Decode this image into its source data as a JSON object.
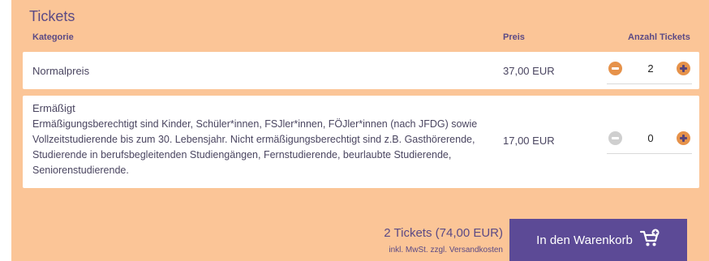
{
  "section": {
    "title": "Tickets",
    "headers": {
      "category": "Kategorie",
      "price": "Preis",
      "quantity": "Anzahl Tickets"
    }
  },
  "rows": [
    {
      "label": "Normalpreis",
      "price": "37,00 EUR",
      "quantity": "2",
      "minus_enabled": true
    },
    {
      "label": "Ermäßigt",
      "description": "Ermäßigungsberechtigt sind Kinder, Schüler*innen, FSJler*innen, FÖJler*innen (nach JFDG) sowie Vollzeitstudierende bis zum 30. Lebensjahr. Nicht ermäßigungsberechtigt sind z.B. Gasthörerende, Studierende in berufsbegleitenden Studiengängen, Fernstudierende, beurlaubte Studierende, Seniorenstudierende.",
      "price": "17,00 EUR",
      "quantity": "0",
      "minus_enabled": false
    }
  ],
  "summary": {
    "total": "2 Tickets (74,00 EUR)",
    "note": "inkl. MwSt. zzgl. Versandkosten"
  },
  "cart_button": {
    "label": "In den Warenkorb",
    "icon": "cart-plus-icon"
  },
  "colors": {
    "panel_bg": "#fbc597",
    "accent": "#e6924a",
    "brand": "#5c4a96"
  }
}
